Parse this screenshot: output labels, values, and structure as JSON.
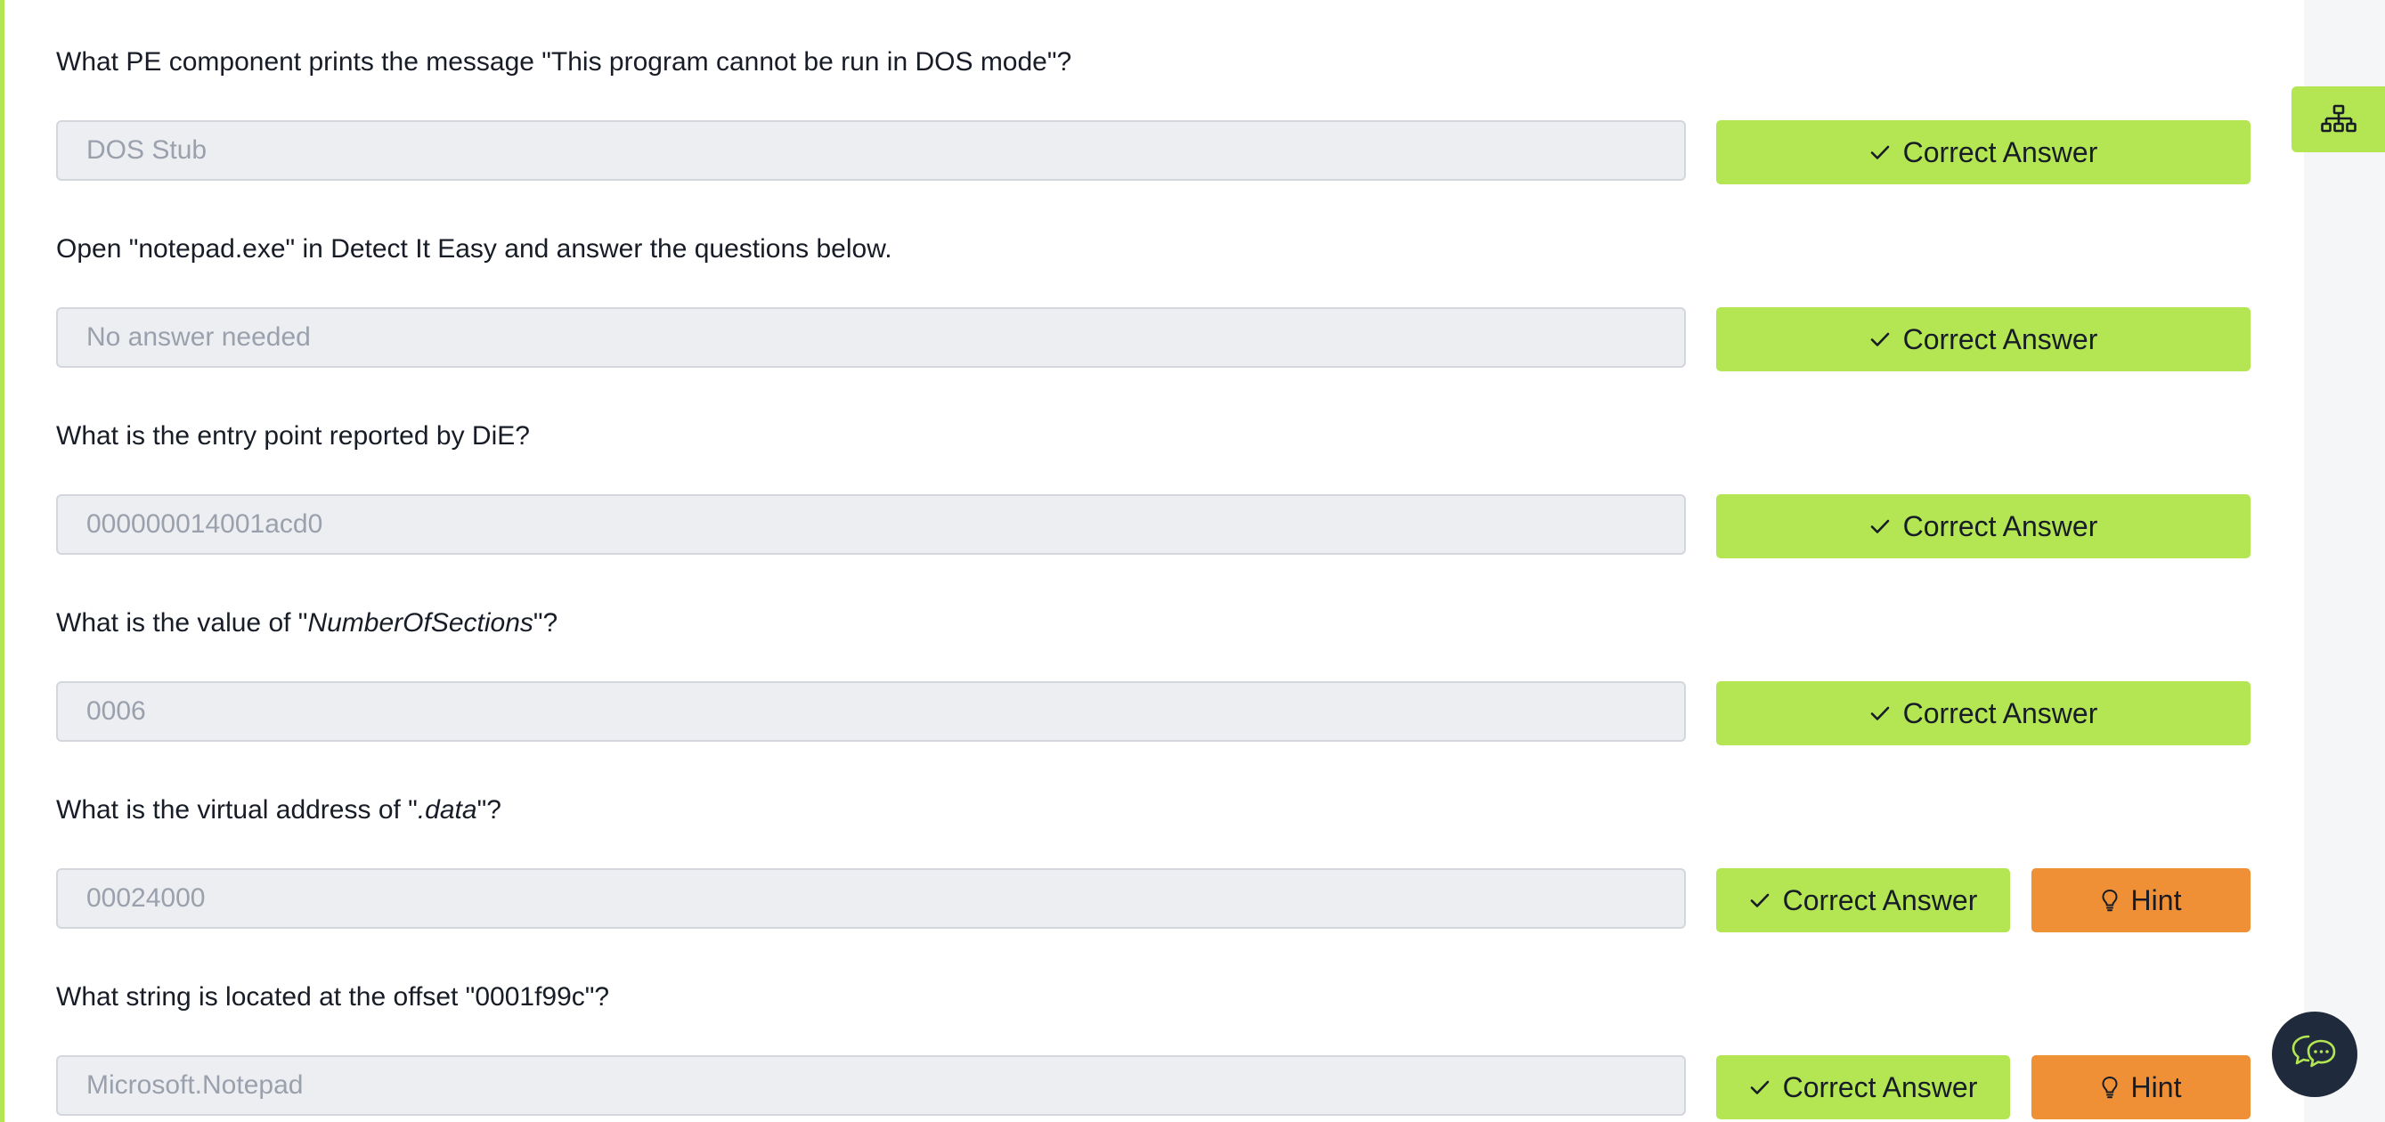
{
  "tasks": [
    {
      "question": "What PE component prints the message \"This program cannot be run in DOS mode\"?",
      "answer": "DOS Stub",
      "correct_label": "Correct Answer"
    },
    {
      "question": "Open \"notepad.exe\" in Detect It Easy and answer the questions below.",
      "answer": "No answer needed",
      "correct_label": "Correct Answer"
    },
    {
      "question": "What is the entry point reported by DiE?",
      "answer": "000000014001acd0",
      "correct_label": "Correct Answer"
    },
    {
      "question_before": "What is the value of \"",
      "question_em": "NumberOfSections",
      "question_after": "\"?",
      "answer": "0006",
      "correct_label": "Correct Answer"
    },
    {
      "question_before": "What is the virtual address of \"",
      "question_em": ".data",
      "question_after": "\"?",
      "answer": "00024000",
      "correct_label": "Correct Answer",
      "hint_label": "Hint"
    },
    {
      "question": "What string is located at the offset \"0001f99c\"?",
      "answer": "Microsoft.Notepad",
      "correct_label": "Correct Answer",
      "hint_label": "Hint"
    }
  ],
  "colors": {
    "accent": "#b3e652",
    "hint": "#ef8f36",
    "chat_bg": "#1f2a3c",
    "input_bg": "#eceef2"
  },
  "icons": {
    "correct": "check-icon",
    "hint": "lightbulb-icon",
    "side": "sitemap-icon",
    "chat": "chat-bubble-icon"
  }
}
